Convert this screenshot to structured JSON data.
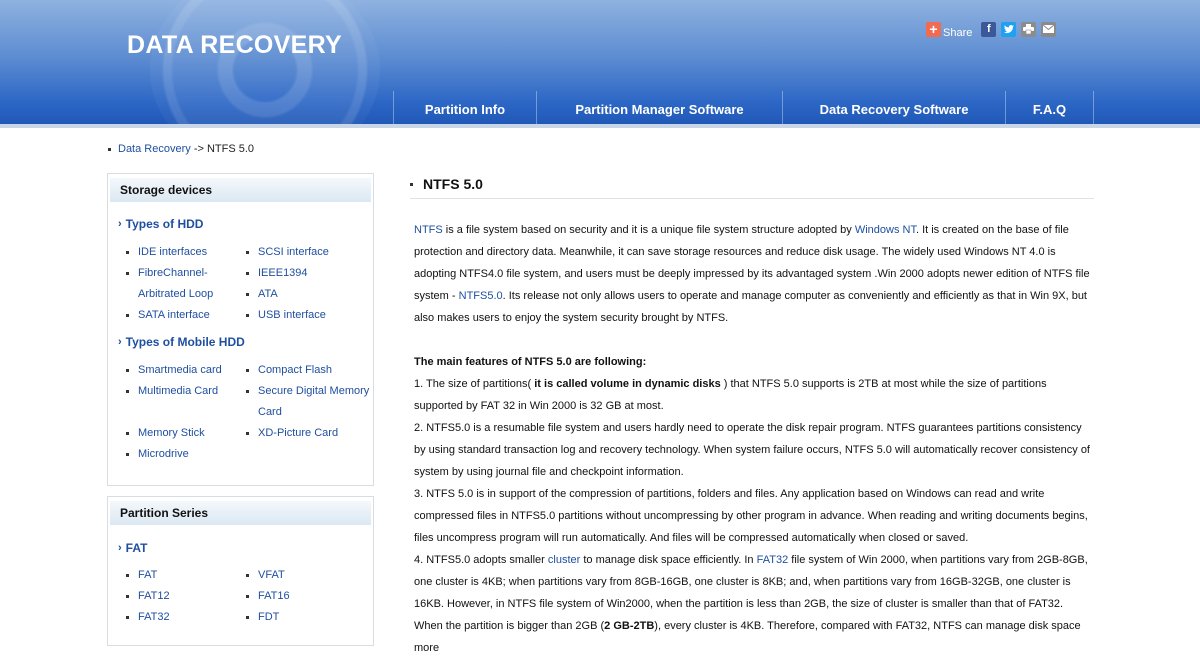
{
  "header": {
    "logo": "DATA RECOVERY",
    "share_label": "Share",
    "share_icons": [
      "share-plus-icon",
      "facebook-icon",
      "twitter-icon",
      "print-icon",
      "email-icon"
    ],
    "nav": [
      {
        "label": "Partition Info"
      },
      {
        "label": "Partition Manager Software"
      },
      {
        "label": "Data Recovery Software"
      },
      {
        "label": "F.A.Q"
      }
    ]
  },
  "breadcrumb": {
    "link": "Data Recovery",
    "separator": " -> ",
    "current": "NTFS 5.0"
  },
  "sidebar": {
    "storage": {
      "title": "Storage devices",
      "groups": [
        {
          "title": "Types of HDD",
          "left": [
            "IDE interfaces",
            "FibreChannel-",
            "Arbitrated Loop",
            "SATA interface"
          ],
          "right": [
            "SCSI interface",
            "IEEE1394",
            "ATA",
            "USB interface"
          ]
        },
        {
          "title": "Types of Mobile HDD",
          "left": [
            "Smartmedia card",
            "Multimedia Card",
            "Memory Stick",
            "Microdrive"
          ],
          "right": [
            "Compact Flash",
            "Secure Digital Memory",
            "Card",
            "XD-Picture Card"
          ]
        }
      ]
    },
    "partition": {
      "title": "Partition Series",
      "group": {
        "title": "FAT",
        "left": [
          "FAT",
          "FAT12",
          "FAT32"
        ],
        "right": [
          "VFAT",
          "FAT16",
          "FDT"
        ]
      }
    }
  },
  "main": {
    "title": "NTFS 5.0",
    "intro": {
      "link1": "NTFS",
      "t1": " is a file system based on security and it is a unique file system structure adopted by ",
      "link2": "Windows NT",
      "t2": ". It is created on the base of file protection and directory data. Meanwhile, it can save storage resources and reduce disk usage. The widely used Windows NT 4.0 is adopting NTFS4.0 file system, and users must be deeply impressed by its advantaged system .Win 2000 adopts newer edition of NTFS file system - ",
      "link3": "NTFS5.0",
      "t3": ". Its release not only allows users to operate and manage computer as conveniently and efficiently as that in Win 9X, but also makes users to enjoy the system security brought by NTFS."
    },
    "features_heading": "The main features of NTFS 5.0 are following:",
    "f1": {
      "a": "1. The size of partitions( ",
      "bold": "it is called volume in dynamic disks",
      "b": " ) that NTFS 5.0 supports is 2TB at most while the size of partitions supported by FAT 32 in Win 2000 is 32 GB at most."
    },
    "f2": "2. NTFS5.0 is a resumable file system and users hardly need to operate the disk repair program. NTFS guarantees partitions consistency by using standard transaction log and recovery technology. When system failure occurs, NTFS 5.0 will automatically recover consistency of system by using journal file and checkpoint information.",
    "f3": "3. NTFS 5.0 is in support of the compression of partitions, folders and files. Any application based on Windows can read and write compressed files in NTFS5.0 partitions without uncompressing by other program in advance. When reading and writing documents begins, files uncompress program will run automatically. And files will be compressed automatically when closed or saved.",
    "f4": {
      "a": "4. NTFS5.0 adopts smaller ",
      "link1": "cluster",
      "b": " to manage disk space efficiently. In ",
      "link2": "FAT32",
      "c": " file system of Win 2000, when partitions vary from 2GB-8GB, one cluster is 4KB; when partitions vary from 8GB-16GB, one cluster is 8KB; and, when partitions vary from 16GB-32GB, one cluster is 16KB. However, in NTFS file system of Win2000, when the partition is less than 2GB, the size of cluster is smaller than that of FAT32. When the partition is bigger than 2GB (",
      "bold": "2 GB-2TB",
      "d": "), every cluster is 4KB. Therefore, compared with FAT32, NTFS can manage disk space more"
    }
  }
}
